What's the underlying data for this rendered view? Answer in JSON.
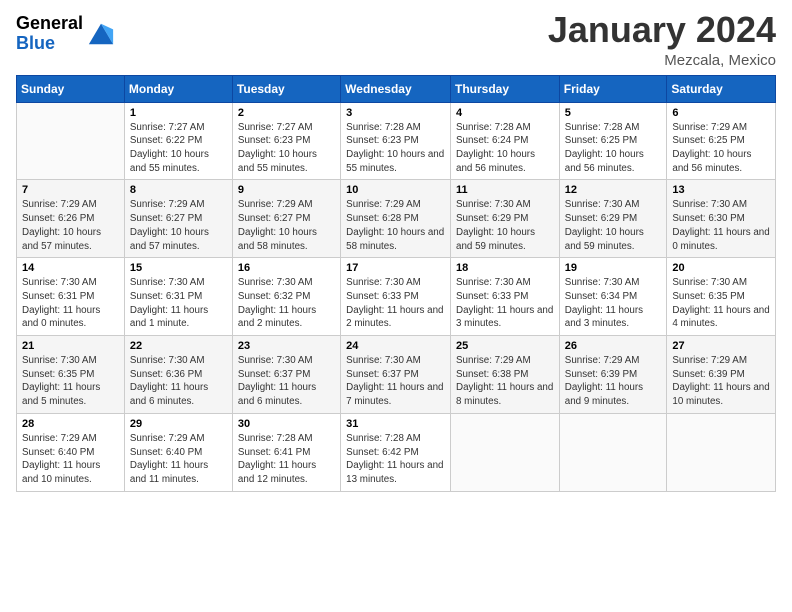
{
  "header": {
    "logo": {
      "line1": "General",
      "line2": "Blue"
    },
    "title": "January 2024",
    "subtitle": "Mezcala, Mexico"
  },
  "columns": [
    "Sunday",
    "Monday",
    "Tuesday",
    "Wednesday",
    "Thursday",
    "Friday",
    "Saturday"
  ],
  "weeks": [
    [
      {
        "day": "",
        "sunrise": "",
        "sunset": "",
        "daylight": ""
      },
      {
        "day": "1",
        "sunrise": "Sunrise: 7:27 AM",
        "sunset": "Sunset: 6:22 PM",
        "daylight": "Daylight: 10 hours and 55 minutes."
      },
      {
        "day": "2",
        "sunrise": "Sunrise: 7:27 AM",
        "sunset": "Sunset: 6:23 PM",
        "daylight": "Daylight: 10 hours and 55 minutes."
      },
      {
        "day": "3",
        "sunrise": "Sunrise: 7:28 AM",
        "sunset": "Sunset: 6:23 PM",
        "daylight": "Daylight: 10 hours and 55 minutes."
      },
      {
        "day": "4",
        "sunrise": "Sunrise: 7:28 AM",
        "sunset": "Sunset: 6:24 PM",
        "daylight": "Daylight: 10 hours and 56 minutes."
      },
      {
        "day": "5",
        "sunrise": "Sunrise: 7:28 AM",
        "sunset": "Sunset: 6:25 PM",
        "daylight": "Daylight: 10 hours and 56 minutes."
      },
      {
        "day": "6",
        "sunrise": "Sunrise: 7:29 AM",
        "sunset": "Sunset: 6:25 PM",
        "daylight": "Daylight: 10 hours and 56 minutes."
      }
    ],
    [
      {
        "day": "7",
        "sunrise": "Sunrise: 7:29 AM",
        "sunset": "Sunset: 6:26 PM",
        "daylight": "Daylight: 10 hours and 57 minutes."
      },
      {
        "day": "8",
        "sunrise": "Sunrise: 7:29 AM",
        "sunset": "Sunset: 6:27 PM",
        "daylight": "Daylight: 10 hours and 57 minutes."
      },
      {
        "day": "9",
        "sunrise": "Sunrise: 7:29 AM",
        "sunset": "Sunset: 6:27 PM",
        "daylight": "Daylight: 10 hours and 58 minutes."
      },
      {
        "day": "10",
        "sunrise": "Sunrise: 7:29 AM",
        "sunset": "Sunset: 6:28 PM",
        "daylight": "Daylight: 10 hours and 58 minutes."
      },
      {
        "day": "11",
        "sunrise": "Sunrise: 7:30 AM",
        "sunset": "Sunset: 6:29 PM",
        "daylight": "Daylight: 10 hours and 59 minutes."
      },
      {
        "day": "12",
        "sunrise": "Sunrise: 7:30 AM",
        "sunset": "Sunset: 6:29 PM",
        "daylight": "Daylight: 10 hours and 59 minutes."
      },
      {
        "day": "13",
        "sunrise": "Sunrise: 7:30 AM",
        "sunset": "Sunset: 6:30 PM",
        "daylight": "Daylight: 11 hours and 0 minutes."
      }
    ],
    [
      {
        "day": "14",
        "sunrise": "Sunrise: 7:30 AM",
        "sunset": "Sunset: 6:31 PM",
        "daylight": "Daylight: 11 hours and 0 minutes."
      },
      {
        "day": "15",
        "sunrise": "Sunrise: 7:30 AM",
        "sunset": "Sunset: 6:31 PM",
        "daylight": "Daylight: 11 hours and 1 minute."
      },
      {
        "day": "16",
        "sunrise": "Sunrise: 7:30 AM",
        "sunset": "Sunset: 6:32 PM",
        "daylight": "Daylight: 11 hours and 2 minutes."
      },
      {
        "day": "17",
        "sunrise": "Sunrise: 7:30 AM",
        "sunset": "Sunset: 6:33 PM",
        "daylight": "Daylight: 11 hours and 2 minutes."
      },
      {
        "day": "18",
        "sunrise": "Sunrise: 7:30 AM",
        "sunset": "Sunset: 6:33 PM",
        "daylight": "Daylight: 11 hours and 3 minutes."
      },
      {
        "day": "19",
        "sunrise": "Sunrise: 7:30 AM",
        "sunset": "Sunset: 6:34 PM",
        "daylight": "Daylight: 11 hours and 3 minutes."
      },
      {
        "day": "20",
        "sunrise": "Sunrise: 7:30 AM",
        "sunset": "Sunset: 6:35 PM",
        "daylight": "Daylight: 11 hours and 4 minutes."
      }
    ],
    [
      {
        "day": "21",
        "sunrise": "Sunrise: 7:30 AM",
        "sunset": "Sunset: 6:35 PM",
        "daylight": "Daylight: 11 hours and 5 minutes."
      },
      {
        "day": "22",
        "sunrise": "Sunrise: 7:30 AM",
        "sunset": "Sunset: 6:36 PM",
        "daylight": "Daylight: 11 hours and 6 minutes."
      },
      {
        "day": "23",
        "sunrise": "Sunrise: 7:30 AM",
        "sunset": "Sunset: 6:37 PM",
        "daylight": "Daylight: 11 hours and 6 minutes."
      },
      {
        "day": "24",
        "sunrise": "Sunrise: 7:30 AM",
        "sunset": "Sunset: 6:37 PM",
        "daylight": "Daylight: 11 hours and 7 minutes."
      },
      {
        "day": "25",
        "sunrise": "Sunrise: 7:29 AM",
        "sunset": "Sunset: 6:38 PM",
        "daylight": "Daylight: 11 hours and 8 minutes."
      },
      {
        "day": "26",
        "sunrise": "Sunrise: 7:29 AM",
        "sunset": "Sunset: 6:39 PM",
        "daylight": "Daylight: 11 hours and 9 minutes."
      },
      {
        "day": "27",
        "sunrise": "Sunrise: 7:29 AM",
        "sunset": "Sunset: 6:39 PM",
        "daylight": "Daylight: 11 hours and 10 minutes."
      }
    ],
    [
      {
        "day": "28",
        "sunrise": "Sunrise: 7:29 AM",
        "sunset": "Sunset: 6:40 PM",
        "daylight": "Daylight: 11 hours and 10 minutes."
      },
      {
        "day": "29",
        "sunrise": "Sunrise: 7:29 AM",
        "sunset": "Sunset: 6:40 PM",
        "daylight": "Daylight: 11 hours and 11 minutes."
      },
      {
        "day": "30",
        "sunrise": "Sunrise: 7:28 AM",
        "sunset": "Sunset: 6:41 PM",
        "daylight": "Daylight: 11 hours and 12 minutes."
      },
      {
        "day": "31",
        "sunrise": "Sunrise: 7:28 AM",
        "sunset": "Sunset: 6:42 PM",
        "daylight": "Daylight: 11 hours and 13 minutes."
      },
      {
        "day": "",
        "sunrise": "",
        "sunset": "",
        "daylight": ""
      },
      {
        "day": "",
        "sunrise": "",
        "sunset": "",
        "daylight": ""
      },
      {
        "day": "",
        "sunrise": "",
        "sunset": "",
        "daylight": ""
      }
    ]
  ]
}
